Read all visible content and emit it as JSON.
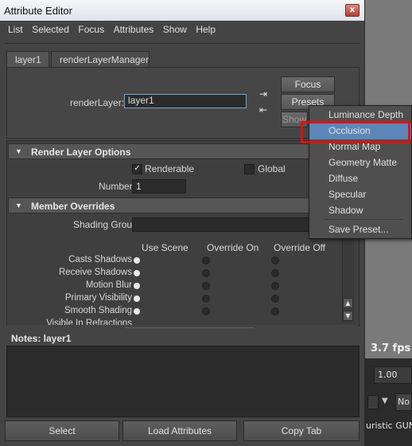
{
  "window": {
    "title": "Attribute Editor",
    "close_glyph": "x"
  },
  "menubar": [
    "List",
    "Selected",
    "Focus",
    "Attributes",
    "Show",
    "Help"
  ],
  "tabs": [
    "layer1",
    "renderLayerManager"
  ],
  "render_layer": {
    "label": "renderLayer:",
    "value": "layer1"
  },
  "buttons": {
    "focus": "Focus",
    "presets": "Presets",
    "show": "Show"
  },
  "render_layer_options": {
    "header": "Render Layer Options",
    "renderable_label": "Renderable",
    "renderable_checked": true,
    "global_label": "Global",
    "global_checked": false,
    "number_label": "Number",
    "number_value": "1"
  },
  "member_overrides": {
    "header": "Member Overrides",
    "shading_group_label": "Shading Group",
    "columns": [
      "Use Scene",
      "Override On",
      "Override Off"
    ],
    "rows": [
      "Casts Shadows",
      "Receive Shadows",
      "Motion Blur",
      "Primary Visibility",
      "Smooth Shading",
      "Visible In Refractions"
    ]
  },
  "notes": {
    "label": "Notes:  layer1"
  },
  "bottom_buttons": {
    "select": "Select",
    "load": "Load Attributes",
    "copy": "Copy Tab"
  },
  "presets_menu": {
    "items": [
      "Luminance Depth",
      "Occlusion",
      "Normal Map",
      "Geometry Matte",
      "Diffuse",
      "Specular",
      "Shadow"
    ],
    "selected": "Occlusion",
    "save_item": "Save Preset..."
  },
  "background": {
    "fps": "3.7 fps",
    "field_value": "1.00",
    "dropdown_value": "No",
    "file_text": "uristic GUN/C"
  },
  "colors": {
    "highlight_box": "#e01010",
    "menu_selection": "#5d87b8"
  }
}
